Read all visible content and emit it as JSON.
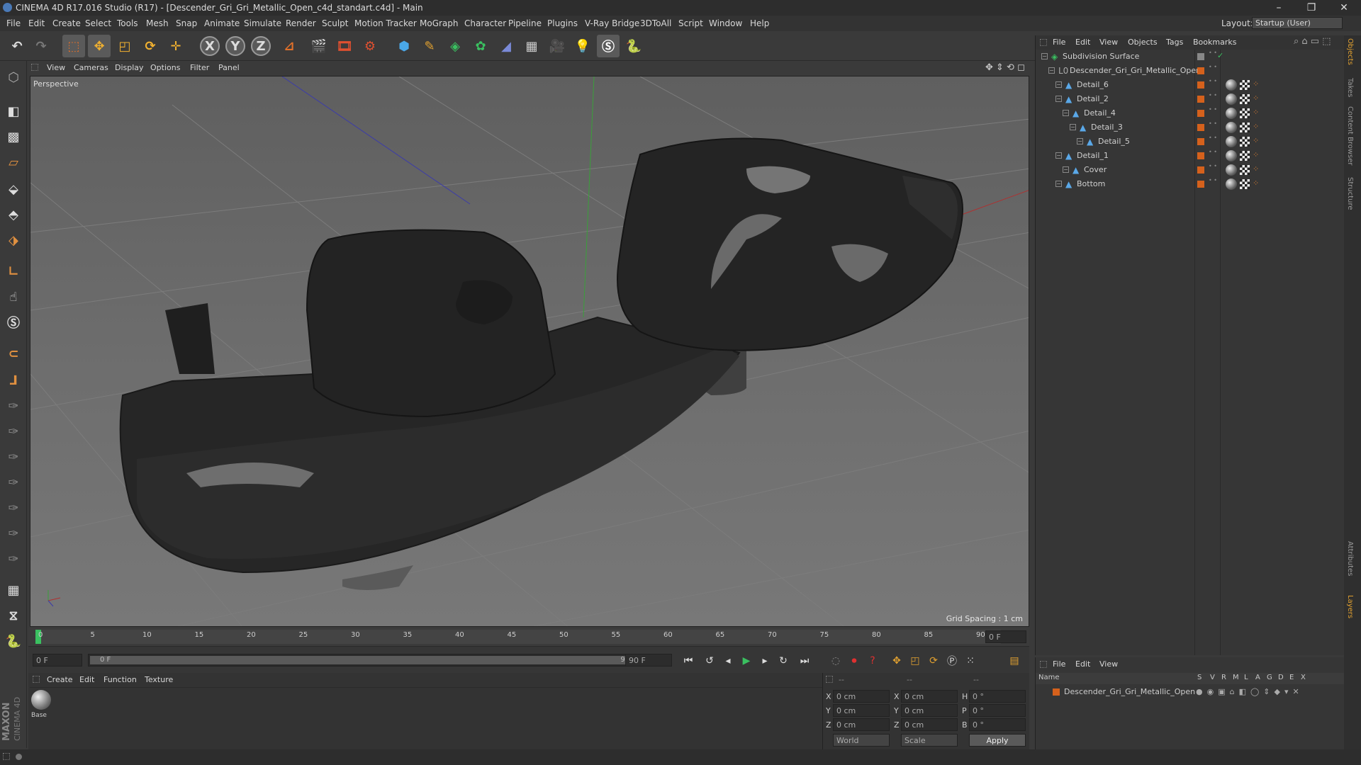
{
  "window": {
    "title": "CINEMA 4D R17.016 Studio (R17) - [Descender_Gri_Gri_Metallic_Open_c4d_standart.c4d] - Main",
    "minimize": "–",
    "maximize": "❐",
    "close": "✕"
  },
  "menu": [
    "File",
    "Edit",
    "Create",
    "Select",
    "Tools",
    "Mesh",
    "Snap",
    "Animate",
    "Simulate",
    "Render",
    "Sculpt",
    "Motion Tracker",
    "MoGraph",
    "Character",
    "Pipeline",
    "Plugins",
    "V-Ray Bridge",
    "3DToAll",
    "Script",
    "Window",
    "Help"
  ],
  "layout": {
    "label": "Layout:",
    "value": "Startup (User)"
  },
  "toolbar": {
    "axis_x": "X",
    "axis_y": "Y",
    "axis_z": "Z"
  },
  "viewport": {
    "menu": [
      "View",
      "Cameras",
      "Display",
      "Options",
      "Filter",
      "Panel"
    ],
    "label": "Perspective",
    "grid_spacing": "Grid Spacing : 1 cm"
  },
  "timeline": {
    "ticks": [
      "0",
      "5",
      "10",
      "15",
      "20",
      "25",
      "30",
      "35",
      "40",
      "45",
      "50",
      "55",
      "60",
      "65",
      "70",
      "75",
      "80",
      "85",
      "90"
    ],
    "current_frame_field": "0 F"
  },
  "transport": {
    "start_field": "0 F",
    "range_start": "0 F",
    "range_end": "90 F",
    "end_field": "90 F"
  },
  "material_manager": {
    "menu": [
      "Create",
      "Edit",
      "Function",
      "Texture"
    ],
    "materials": [
      {
        "name": "Base"
      }
    ]
  },
  "coordinates": {
    "header": [
      "--",
      "--",
      "--"
    ],
    "rows": [
      {
        "a": "X",
        "av": "0 cm",
        "b": "X",
        "bv": "0 cm",
        "c": "H",
        "cv": "0 °"
      },
      {
        "a": "Y",
        "av": "0 cm",
        "b": "Y",
        "bv": "0 cm",
        "c": "P",
        "cv": "0 °"
      },
      {
        "a": "Z",
        "av": "0 cm",
        "b": "Z",
        "bv": "0 cm",
        "c": "B",
        "cv": "0 °"
      }
    ],
    "mode": "World",
    "scale": "Scale",
    "apply": "Apply"
  },
  "object_manager": {
    "menu": [
      "File",
      "Edit",
      "View",
      "Objects",
      "Tags",
      "Bookmarks"
    ],
    "objects": [
      {
        "name": "Subdivision Surface",
        "indent": 0,
        "type": "subdiv"
      },
      {
        "name": "Descender_Gri_Gri_Metallic_Open",
        "indent": 1,
        "type": "null"
      },
      {
        "name": "Detail_6",
        "indent": 2,
        "type": "poly"
      },
      {
        "name": "Detail_2",
        "indent": 2,
        "type": "poly"
      },
      {
        "name": "Detail_4",
        "indent": 3,
        "type": "poly"
      },
      {
        "name": "Detail_3",
        "indent": 4,
        "type": "poly"
      },
      {
        "name": "Detail_5",
        "indent": 5,
        "type": "poly"
      },
      {
        "name": "Detail_1",
        "indent": 2,
        "type": "poly"
      },
      {
        "name": "Cover",
        "indent": 3,
        "type": "poly"
      },
      {
        "name": "Bottom",
        "indent": 2,
        "type": "poly"
      }
    ]
  },
  "layer_manager": {
    "menu": [
      "File",
      "Edit",
      "View"
    ],
    "columns": [
      "Name",
      "S",
      "V",
      "R",
      "M",
      "L",
      "A",
      "G",
      "D",
      "E",
      "X"
    ],
    "layers": [
      {
        "name": "Descender_Gri_Gri_Metallic_Open"
      }
    ]
  },
  "right_tabs": [
    "Objects",
    "Takes",
    "Content Browser",
    "Structure",
    "Attributes",
    "Layers"
  ],
  "brand": {
    "line1": "MAXON",
    "line2": "CINEMA 4D"
  }
}
